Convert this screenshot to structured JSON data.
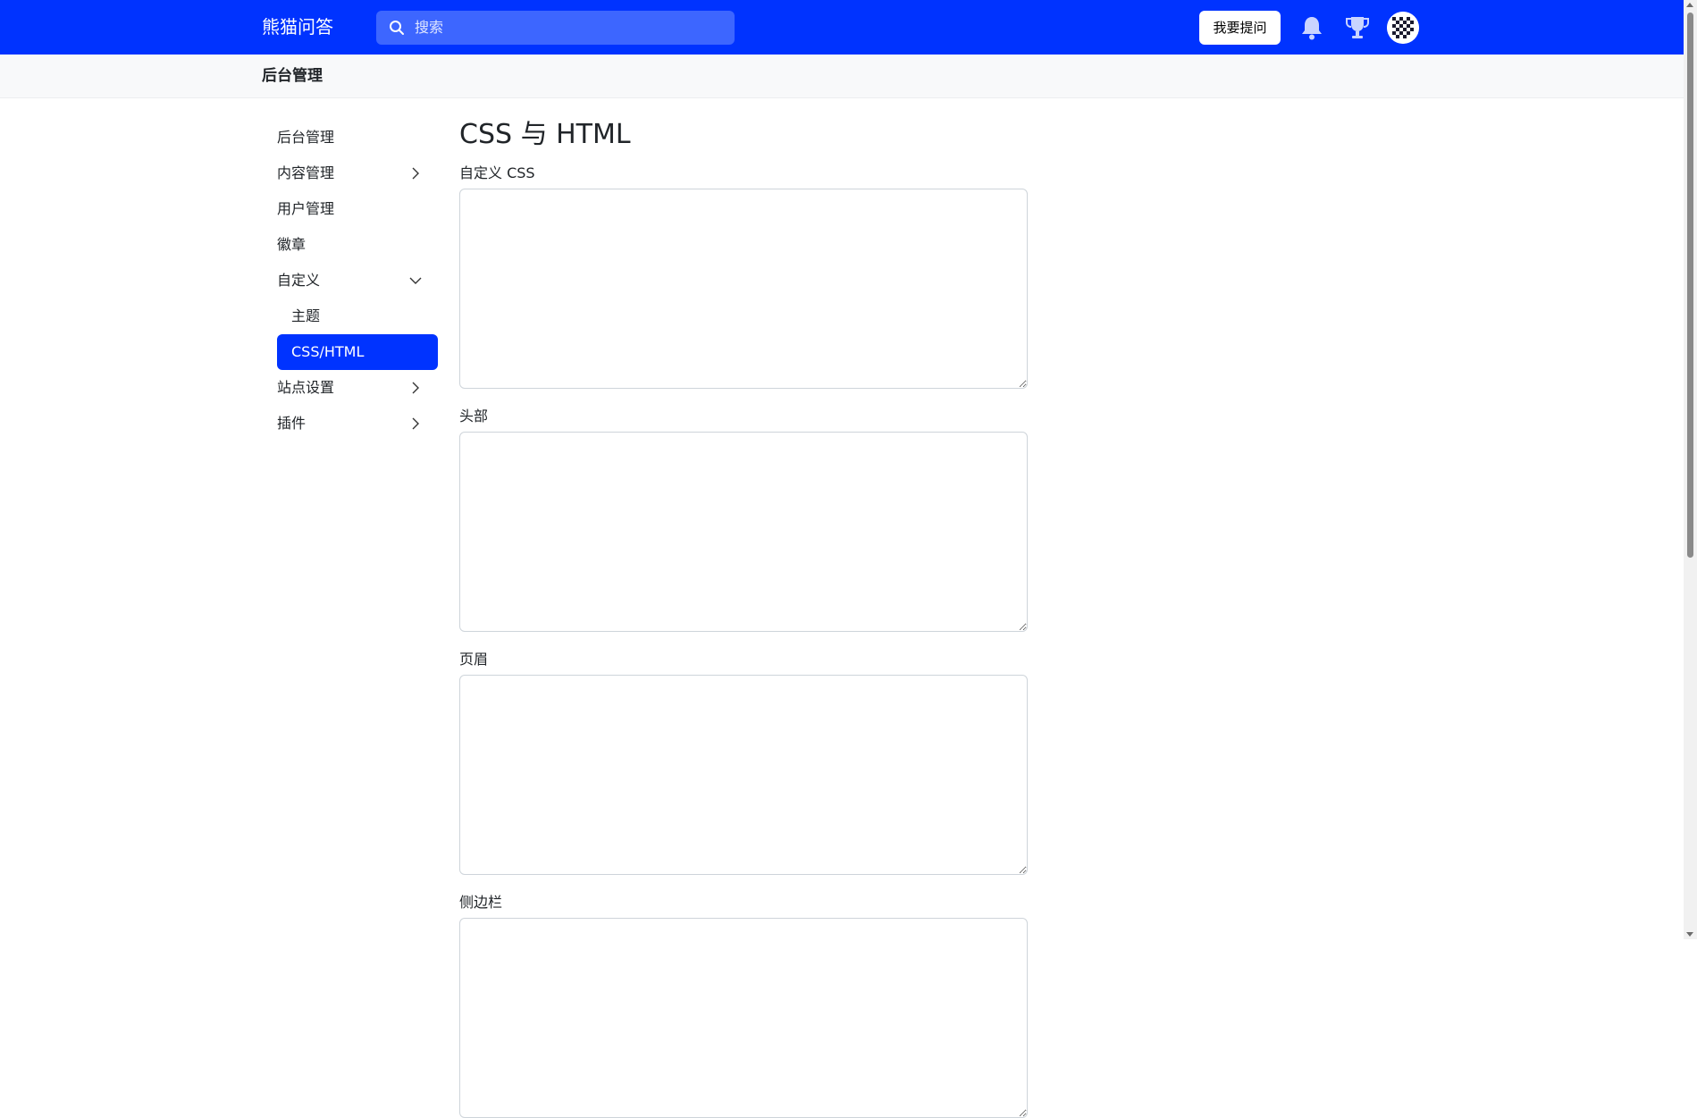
{
  "header": {
    "brand": "熊猫问答",
    "search_placeholder": "搜索",
    "ask_button": "我要提问",
    "icons": [
      "search-icon",
      "bell-icon",
      "trophy-icon",
      "avatar"
    ]
  },
  "subheader": {
    "title": "后台管理"
  },
  "sidebar": {
    "items": [
      {
        "label": "后台管理"
      },
      {
        "label": "内容管理",
        "chevron": "right"
      },
      {
        "label": "用户管理"
      },
      {
        "label": "徽章"
      },
      {
        "label": "自定义",
        "chevron": "down"
      },
      {
        "label": "主题"
      },
      {
        "label": "CSS/HTML",
        "active": true
      },
      {
        "label": "站点设置",
        "chevron": "right"
      },
      {
        "label": "插件",
        "chevron": "right"
      }
    ]
  },
  "main": {
    "title": "CSS 与 HTML",
    "fields": [
      {
        "label": "自定义 CSS",
        "value": ""
      },
      {
        "label": "头部",
        "value": ""
      },
      {
        "label": "页眉",
        "value": ""
      },
      {
        "label": "侧边栏",
        "value": ""
      }
    ]
  },
  "colors": {
    "primary": "#0033ff",
    "search_bg": "#3d66ff"
  }
}
